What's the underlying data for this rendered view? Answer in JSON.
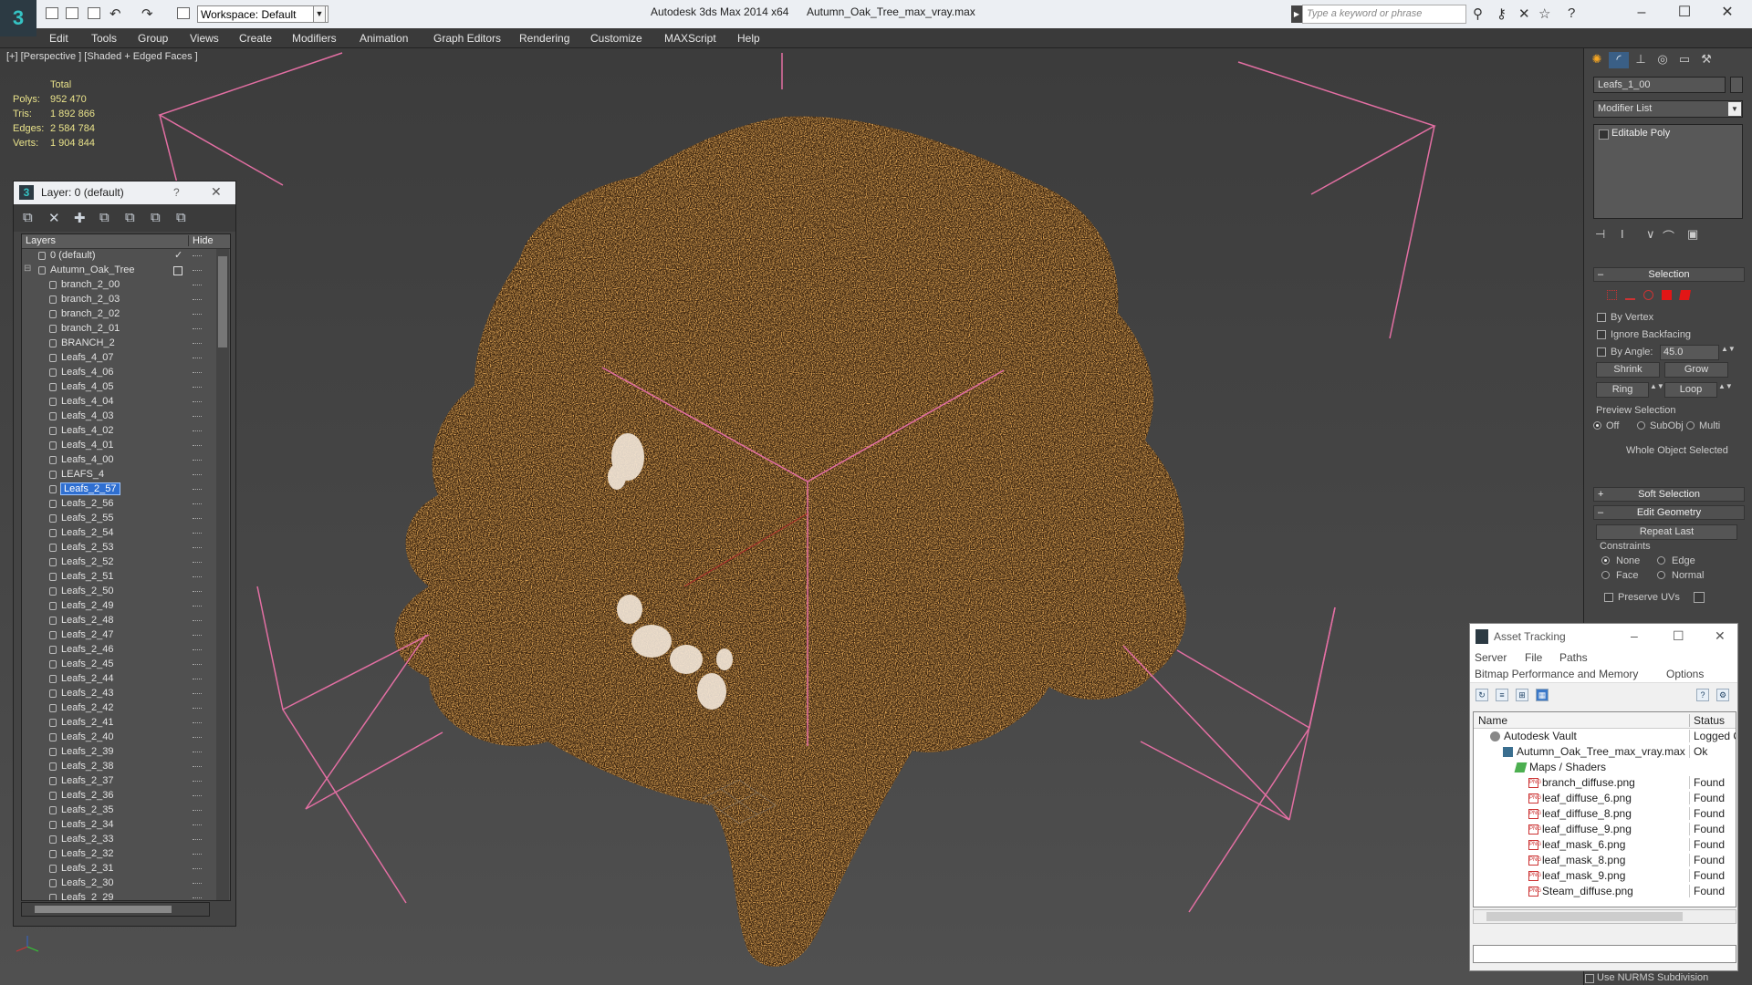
{
  "titlebar": {
    "workspace": "Workspace: Default",
    "app_title": "Autodesk 3ds Max  2014 x64",
    "file_name": "Autumn_Oak_Tree_max_vray.max",
    "search_placeholder": "Type a keyword or phrase",
    "logo_glyph": "3"
  },
  "menubar": {
    "items": [
      "Edit",
      "Tools",
      "Group",
      "Views",
      "Create",
      "Modifiers",
      "Animation",
      "Graph Editors",
      "Rendering",
      "Customize",
      "MAXScript",
      "Help"
    ]
  },
  "viewport": {
    "label": "[+] [Perspective ] [Shaded + Edged Faces ]",
    "stats": {
      "total_label": "Total",
      "polys_label": "Polys:",
      "polys": "952 470",
      "tris_label": "Tris:",
      "tris": "1 892 866",
      "edges_label": "Edges:",
      "edges": "2 584 784",
      "verts_label": "Verts:",
      "verts": "1 904 844"
    },
    "colors": {
      "bbox": "#e36fa3",
      "foliage": "#c86a1e",
      "selected_leaves": "#f2e6d8"
    }
  },
  "layer_panel": {
    "title": "Layer: 0 (default)",
    "help": "?",
    "col_layers": "Layers",
    "col_hide": "Hide",
    "rows": [
      {
        "name": "0 (default)",
        "level": 0,
        "kind": "layer",
        "check": true
      },
      {
        "name": "Autumn_Oak_Tree",
        "level": 0,
        "kind": "group",
        "box": true
      },
      {
        "name": "branch_2_00",
        "level": 1
      },
      {
        "name": "branch_2_03",
        "level": 1
      },
      {
        "name": "branch_2_02",
        "level": 1
      },
      {
        "name": "branch_2_01",
        "level": 1
      },
      {
        "name": "BRANCH_2",
        "level": 1
      },
      {
        "name": "Leafs_4_07",
        "level": 1
      },
      {
        "name": "Leafs_4_06",
        "level": 1
      },
      {
        "name": "Leafs_4_05",
        "level": 1
      },
      {
        "name": "Leafs_4_04",
        "level": 1
      },
      {
        "name": "Leafs_4_03",
        "level": 1
      },
      {
        "name": "Leafs_4_02",
        "level": 1
      },
      {
        "name": "Leafs_4_01",
        "level": 1
      },
      {
        "name": "Leafs_4_00",
        "level": 1
      },
      {
        "name": "LEAFS_4",
        "level": 1
      },
      {
        "name": "Leafs_2_57",
        "level": 1,
        "selected": true
      },
      {
        "name": "Leafs_2_56",
        "level": 1
      },
      {
        "name": "Leafs_2_55",
        "level": 1
      },
      {
        "name": "Leafs_2_54",
        "level": 1
      },
      {
        "name": "Leafs_2_53",
        "level": 1
      },
      {
        "name": "Leafs_2_52",
        "level": 1
      },
      {
        "name": "Leafs_2_51",
        "level": 1
      },
      {
        "name": "Leafs_2_50",
        "level": 1
      },
      {
        "name": "Leafs_2_49",
        "level": 1
      },
      {
        "name": "Leafs_2_48",
        "level": 1
      },
      {
        "name": "Leafs_2_47",
        "level": 1
      },
      {
        "name": "Leafs_2_46",
        "level": 1
      },
      {
        "name": "Leafs_2_45",
        "level": 1
      },
      {
        "name": "Leafs_2_44",
        "level": 1
      },
      {
        "name": "Leafs_2_43",
        "level": 1
      },
      {
        "name": "Leafs_2_42",
        "level": 1
      },
      {
        "name": "Leafs_2_41",
        "level": 1
      },
      {
        "name": "Leafs_2_40",
        "level": 1
      },
      {
        "name": "Leafs_2_39",
        "level": 1
      },
      {
        "name": "Leafs_2_38",
        "level": 1
      },
      {
        "name": "Leafs_2_37",
        "level": 1
      },
      {
        "name": "Leafs_2_36",
        "level": 1
      },
      {
        "name": "Leafs_2_35",
        "level": 1
      },
      {
        "name": "Leafs_2_34",
        "level": 1
      },
      {
        "name": "Leafs_2_33",
        "level": 1
      },
      {
        "name": "Leafs_2_32",
        "level": 1
      },
      {
        "name": "Leafs_2_31",
        "level": 1
      },
      {
        "name": "Leafs_2_30",
        "level": 1
      },
      {
        "name": "Leafs_2_29",
        "level": 1
      }
    ]
  },
  "command_panel": {
    "object_name": "Leafs_1_00",
    "modifier_list": "Modifier List",
    "stack_item": "Editable Poly",
    "selection": {
      "title": "Selection",
      "by_vertex": "By Vertex",
      "ignore_backfacing": "Ignore Backfacing",
      "by_angle": "By Angle:",
      "angle_value": "45.0",
      "shrink": "Shrink",
      "grow": "Grow",
      "ring": "Ring",
      "loop": "Loop",
      "preview_selection": "Preview Selection",
      "off": "Off",
      "subobj": "SubObj",
      "multi": "Multi",
      "whole_object": "Whole Object Selected"
    },
    "soft_selection": "Soft Selection",
    "edit_geometry": {
      "title": "Edit Geometry",
      "repeat_last": "Repeat Last",
      "constraints": "Constraints",
      "none": "None",
      "edge": "Edge",
      "face": "Face",
      "normal": "Normal",
      "preserve_uvs": "Preserve UVs"
    },
    "nurms": "Use NURMS Subdivision"
  },
  "asset_tracking": {
    "title": "Asset Tracking",
    "menu1": [
      "Server",
      "File",
      "Paths"
    ],
    "menu2": [
      "Bitmap Performance and Memory",
      "Options"
    ],
    "col_name": "Name",
    "col_status": "Status",
    "rows": [
      {
        "name": "Autodesk Vault",
        "status": "Logged Out",
        "level": 0,
        "icon": "vault"
      },
      {
        "name": "Autumn_Oak_Tree_max_vray.max",
        "status": "Ok",
        "level": 1,
        "icon": "max"
      },
      {
        "name": "Maps / Shaders",
        "status": "",
        "level": 2,
        "icon": "maps"
      },
      {
        "name": "branch_diffuse.png",
        "status": "Found",
        "level": 3,
        "icon": "png"
      },
      {
        "name": "leaf_diffuse_6.png",
        "status": "Found",
        "level": 3,
        "icon": "png"
      },
      {
        "name": "leaf_diffuse_8.png",
        "status": "Found",
        "level": 3,
        "icon": "png"
      },
      {
        "name": "leaf_diffuse_9.png",
        "status": "Found",
        "level": 3,
        "icon": "png"
      },
      {
        "name": "leaf_mask_6.png",
        "status": "Found",
        "level": 3,
        "icon": "png"
      },
      {
        "name": "leaf_mask_8.png",
        "status": "Found",
        "level": 3,
        "icon": "png"
      },
      {
        "name": "leaf_mask_9.png",
        "status": "Found",
        "level": 3,
        "icon": "png"
      },
      {
        "name": "Steam_diffuse.png",
        "status": "Found",
        "level": 3,
        "icon": "png"
      }
    ]
  }
}
